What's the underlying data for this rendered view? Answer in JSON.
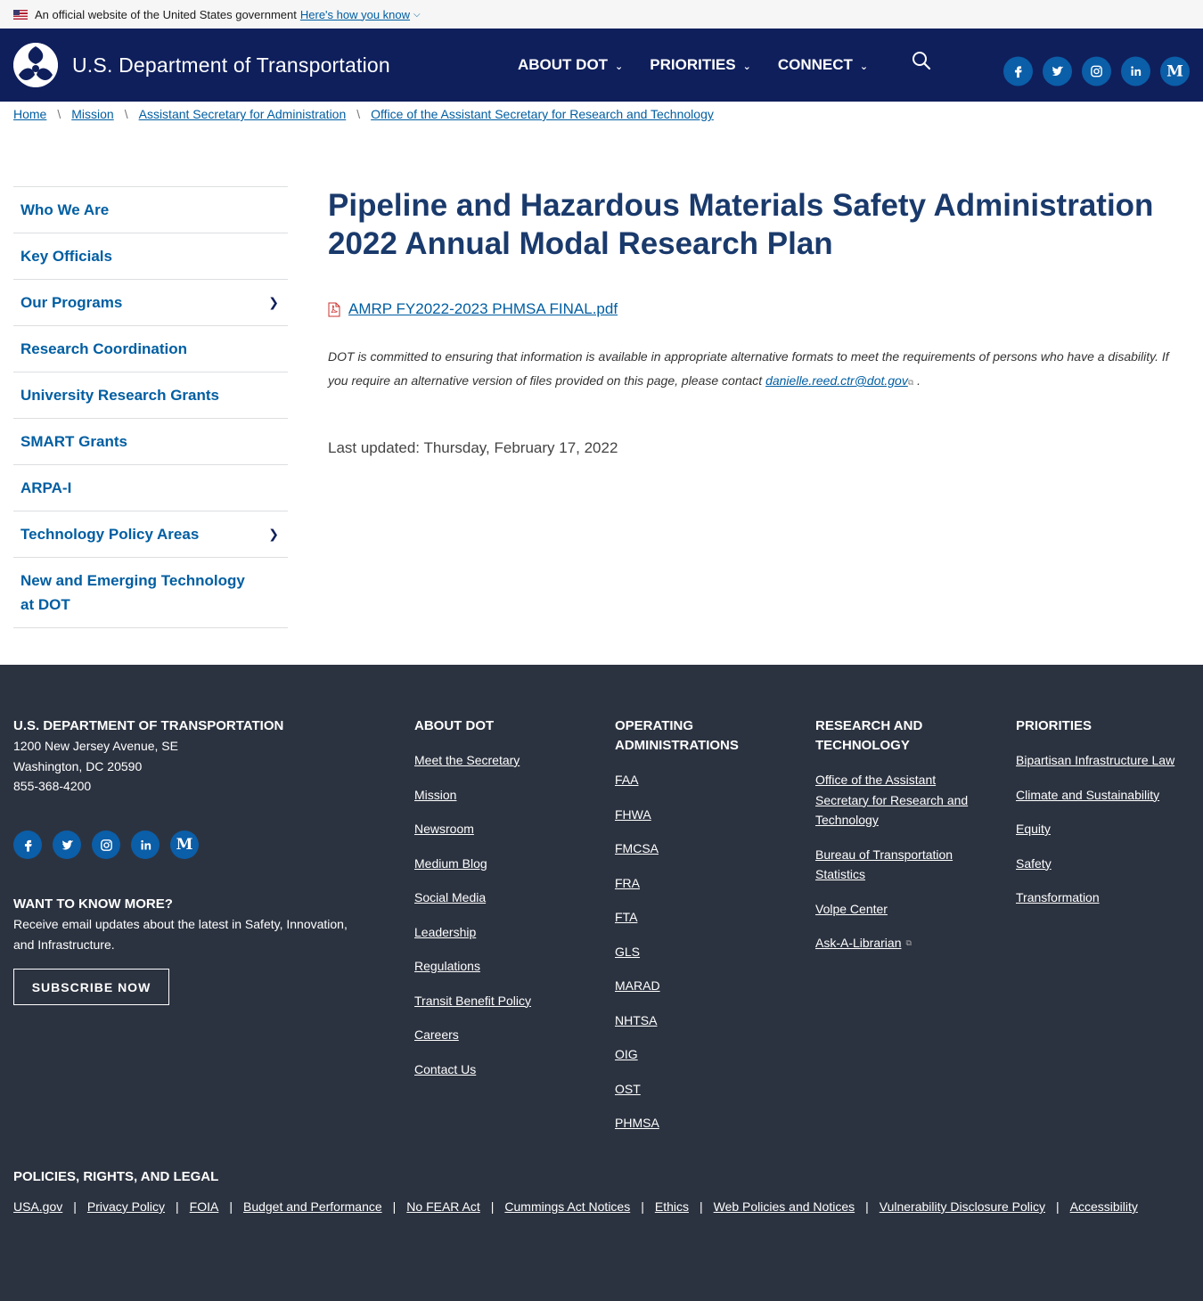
{
  "gov_banner": {
    "text": "An official website of the United States government",
    "link": "Here's how you know"
  },
  "header": {
    "logo_text": "U.S. Department of Transportation",
    "nav": [
      {
        "label": "ABOUT DOT"
      },
      {
        "label": "PRIORITIES"
      },
      {
        "label": "CONNECT"
      }
    ],
    "social": [
      "facebook-icon",
      "twitter-icon",
      "instagram-icon",
      "linkedin-icon",
      "medium-icon"
    ]
  },
  "breadcrumb": [
    "Home",
    "Mission",
    "Assistant Secretary for Administration",
    "Office of the Assistant Secretary for Research and Technology"
  ],
  "sidebar": {
    "items": [
      {
        "label": "Who We Are",
        "has_arrow": false
      },
      {
        "label": "Key Officials",
        "has_arrow": false
      },
      {
        "label": "Our Programs",
        "has_arrow": true
      },
      {
        "label": "Research Coordination",
        "has_arrow": false
      },
      {
        "label": "University Research Grants",
        "has_arrow": false
      },
      {
        "label": "SMART Grants",
        "has_arrow": false
      },
      {
        "label": "ARPA-I",
        "has_arrow": false
      },
      {
        "label": "Technology Policy Areas",
        "has_arrow": true
      },
      {
        "label": "New and Emerging Technology at DOT",
        "has_arrow": false
      }
    ]
  },
  "main": {
    "title": "Pipeline and Hazardous Materials Safety Administration 2022 Annual Modal Research Plan",
    "file_link": "AMRP FY2022-2023 PHMSA FINAL.pdf",
    "access_note": "DOT is committed to ensuring that information is available in appropriate alternative formats to meet the requirements of persons who have a disability. If you require an alternative version of files provided on this page, please contact",
    "contact_email": "danielle.reed.ctr@dot.gov",
    "access_note_end": ".",
    "last_updated": "Last updated: Thursday, February 17, 2022"
  },
  "footer": {
    "org_title": "U.S. DEPARTMENT OF TRANSPORTATION",
    "address": [
      "1200 New Jersey Avenue, SE",
      "Washington, DC 20590",
      "855-368-4200"
    ],
    "want_title": "WANT TO KNOW MORE?",
    "want_text": "Receive email updates about the latest in Safety, Innovation, and Infrastructure.",
    "subscribe": "SUBSCRIBE NOW",
    "about": {
      "title": "ABOUT DOT",
      "links": [
        "Meet the Secretary",
        "Mission",
        "Newsroom",
        "Medium Blog",
        "Social Media",
        "Leadership",
        "Regulations",
        "Transit Benefit Policy",
        "Careers",
        "Contact Us"
      ]
    },
    "operating": {
      "title": "OPERATING ADMINISTRATIONS",
      "links": [
        "FAA",
        "FHWA",
        "FMCSA",
        "FRA",
        "FTA",
        "GLS",
        "MARAD",
        "NHTSA",
        "OIG",
        "OST",
        "PHMSA"
      ]
    },
    "research": {
      "title": "RESEARCH AND TECHNOLOGY",
      "links": [
        "Office of the Assistant Secretary for Research and Technology",
        "Bureau of Transportation Statistics",
        "Volpe Center",
        "Ask-A-Librarian"
      ]
    },
    "priorities": {
      "title": "PRIORITIES",
      "links": [
        "Bipartisan Infrastructure Law",
        "Climate and Sustainability",
        "Equity",
        "Safety",
        "Transformation"
      ]
    },
    "policies_title": "POLICIES, RIGHTS, AND LEGAL",
    "policy_links": [
      "USA.gov",
      "Privacy Policy",
      "FOIA",
      "Budget and Performance",
      "No FEAR Act",
      "Cummings Act Notices",
      "Ethics",
      "Web Policies and Notices",
      "Vulnerability Disclosure Policy",
      "Accessibility"
    ]
  }
}
